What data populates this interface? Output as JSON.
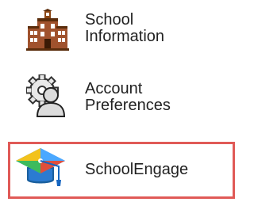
{
  "menu": {
    "items": [
      {
        "label": "School\nInformation",
        "icon": "school-building-icon"
      },
      {
        "label": "Account\nPreferences",
        "icon": "account-preferences-icon"
      },
      {
        "label": "SchoolEngage",
        "icon": "graduation-cap-icon",
        "highlighted": true
      }
    ],
    "colors": {
      "highlight_border": "#e05a57",
      "text": "#222222",
      "building_brick": "#a0522d",
      "cap_blue": "#1e90ff",
      "cap_dark": "#1a5f9e",
      "tassel": "#1565c0"
    }
  }
}
